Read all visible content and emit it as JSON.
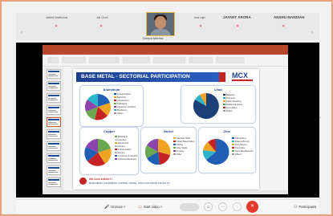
{
  "gallery": {
    "participants": [
      {
        "name": "Jaikrit Malhotra"
      },
      {
        "name": "Jai Goel"
      },
      {
        "name": "iwa rajn"
      },
      {
        "name": "JAYANT ARORA",
        "bold": true
      },
      {
        "name": "ANSHU MANDIAN",
        "bold": true
      }
    ],
    "featured_name": "Deepa Mahtra"
  },
  "slide": {
    "title": "BASE METAL - SECTORIAL PARTICIPATION",
    "logo_text": "MCX",
    "panels": [
      {
        "title": "Aluminium",
        "legend": [
          "Transportation",
          "Electricity",
          "Construction",
          "Packaging",
          "Consumer Durables",
          "Machinery",
          "Others"
        ]
      },
      {
        "title": "Lead",
        "legend": [
          "Batteries",
          "Pigments",
          "Cable sheathing",
          "Rolled extrusions",
          "Ammunition",
          "Others"
        ]
      },
      {
        "title": "Copper",
        "legend": [
          "Building & Construction",
          "Electrical & Electronics",
          "Transportation Equipment",
          "Consumer & General",
          "Industrial Machinery"
        ]
      },
      {
        "title": "Nickel",
        "legend": [
          "Stainless Steel",
          "Nickel Based Alloys",
          "Plating",
          "Alloy Steels",
          "Foundry",
          "Other"
        ]
      },
      {
        "title": "Zinc",
        "legend": [
          "Galvanizing",
          "Brass & Bronze",
          "Zinc Alloying",
          "Chemicals",
          "Semi-Manufactures",
          "Others"
        ]
      }
    ],
    "footer_title": "WE HAVE ENERGY !",
    "footer_sub": "BASE METAL (ALUMINIUM, COPPER, NICKEL, ZINC) FOR PRICE VOLATILITY"
  },
  "toolbar": {
    "unmute": "Unmute",
    "start_video": "Start video",
    "participants": "Participants"
  },
  "colors": {
    "frame_border": "#e8a27a",
    "slide_header": "#1b3f8f",
    "accent_red": "#c42424",
    "end_call": "#e23b2b"
  }
}
